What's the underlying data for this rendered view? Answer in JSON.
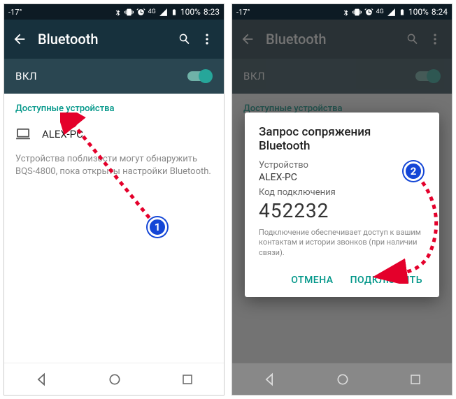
{
  "left": {
    "status": {
      "temperature": "-17°",
      "battery_pct": "100%",
      "time": "8:23",
      "net": "4G"
    },
    "header": {
      "title": "Bluetooth"
    },
    "toggle": {
      "label": "ВКЛ"
    },
    "section_label": "Доступные устройства",
    "device": {
      "name": "ALEX-PC"
    },
    "hint": "Устройства поблизости могут обнаружить BQS-4800, пока открыты настройки Bluetooth."
  },
  "right": {
    "status": {
      "temperature": "-17°",
      "battery_pct": "100%",
      "time": "8:24",
      "net": "4G"
    },
    "header": {
      "title": "Bluetooth"
    },
    "toggle": {
      "label": "ВКЛ"
    },
    "section_label": "Доступные устройства",
    "dialog": {
      "title": "Запрос сопряжения Bluetooth",
      "device_label": "Устройство",
      "device_name": "ALEX-PC",
      "code_label": "Код подключения",
      "code": "452232",
      "note": "Подключение обеспечивает доступ к вашим контактам и истории звонков (при наличии связи).",
      "cancel": "ОТМЕНА",
      "connect": "ПОДКЛЮЧИТЬ"
    }
  },
  "badges": {
    "one": "1",
    "two": "2"
  }
}
